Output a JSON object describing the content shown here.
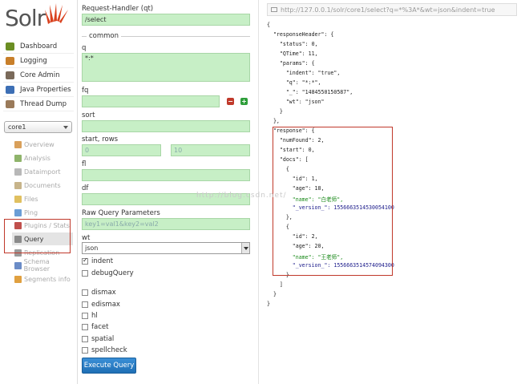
{
  "logo": {
    "text": "Solr"
  },
  "sidebar": {
    "main_items": [
      {
        "label": "Dashboard",
        "icon": "dashboard-icon",
        "color": "#6b8e23"
      },
      {
        "label": "Logging",
        "icon": "logging-icon",
        "color": "#c87f2a"
      },
      {
        "label": "Core Admin",
        "icon": "core-admin-icon",
        "color": "#7a6a5a"
      },
      {
        "label": "Java Properties",
        "icon": "java-properties-icon",
        "color": "#3d6fb5"
      },
      {
        "label": "Thread Dump",
        "icon": "thread-dump-icon",
        "color": "#9a7a5a"
      }
    ],
    "core_selector": "core1",
    "core_items": [
      {
        "label": "Overview",
        "icon": "overview-icon",
        "color": "#d9a05b"
      },
      {
        "label": "Analysis",
        "icon": "analysis-icon",
        "color": "#8fb46b"
      },
      {
        "label": "Dataimport",
        "icon": "dataimport-icon",
        "color": "#b8b8b8"
      },
      {
        "label": "Documents",
        "icon": "documents-icon",
        "color": "#c7b48a"
      },
      {
        "label": "Files",
        "icon": "files-icon",
        "color": "#e0c060"
      },
      {
        "label": "Ping",
        "icon": "ping-icon",
        "color": "#6b9ed6"
      },
      {
        "label": "Plugins / Stats",
        "icon": "plugins-icon",
        "color": "#c0504d"
      },
      {
        "label": "Query",
        "icon": "query-icon",
        "color": "#8a8a8a"
      },
      {
        "label": "Replication",
        "icon": "replication-icon",
        "color": "#9a9a9a"
      },
      {
        "label": "Schema Browser",
        "icon": "schema-browser-icon",
        "color": "#6b8cc7"
      },
      {
        "label": "Segments info",
        "icon": "segments-icon",
        "color": "#e0a040"
      }
    ]
  },
  "form": {
    "request_handler_label": "Request-Handler (qt)",
    "request_handler_value": "/select",
    "common_legend": "common",
    "q_label": "q",
    "q_value": "*:*",
    "fq_label": "fq",
    "fq_value": "",
    "sort_label": "sort",
    "sort_value": "",
    "start_rows_label": "start, rows",
    "start_value": "0",
    "rows_value": "10",
    "fl_label": "fl",
    "fl_value": "",
    "df_label": "df",
    "df_value": "",
    "raw_label": "Raw Query Parameters",
    "raw_placeholder": "key1=val1&key2=val2",
    "wt_label": "wt",
    "wt_value": "json",
    "indent_label": "indent",
    "debug_label": "debugQuery",
    "dismax_label": "dismax",
    "edismax_label": "edismax",
    "hl_label": "hl",
    "facet_label": "facet",
    "spatial_label": "spatial",
    "spellcheck_label": "spellcheck",
    "execute_label": "Execute Query",
    "remove_symbol": "−",
    "add_symbol": "+"
  },
  "url_bar": "http://127.0.0.1/solr/core1/select?q=*%3A*&wt=json&indent=true",
  "response_lines": [
    "{",
    "  \"responseHeader\": {",
    "    \"status\": 0,",
    "    \"QTime\": 11,",
    "    \"params\": {",
    "      \"indent\": \"true\",",
    "      \"q\": \"*:*\",",
    "      \"_\": \"1484550150587\",",
    "      \"wt\": \"json\"",
    "    }",
    "  },",
    "  \"response\": {",
    "    \"numFound\": 2,",
    "    \"start\": 0,",
    "    \"docs\": [",
    "      {",
    "        \"id\": 1,",
    "        \"age\": 18,",
    "        \"name\": \"白老师\",",
    "        \"_version_\": 1556663514530054100",
    "      },",
    "      {",
    "        \"id\": 2,",
    "        \"age\": 20,",
    "        \"name\": \"王老师\",",
    "        \"_version_\": 1556663514574094300",
    "      }",
    "    ]",
    "  }",
    "}"
  ],
  "watermark": "http://blog.csdn.net/"
}
